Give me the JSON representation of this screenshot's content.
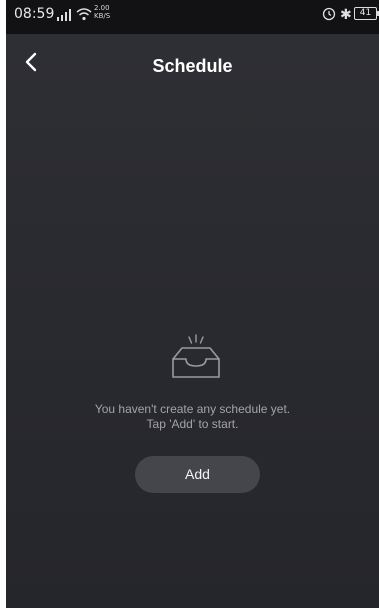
{
  "status_bar": {
    "time": "08:59",
    "speed_value": "2.00",
    "speed_unit": "KB/S",
    "battery": "41",
    "icons": [
      "signal-icon",
      "wifi-icon",
      "alarm-icon",
      "bluetooth-icon",
      "battery-icon"
    ]
  },
  "header": {
    "title": "Schedule",
    "back_icon": "chevron-left-icon"
  },
  "empty_state": {
    "icon": "empty-tray-icon",
    "line1": "You haven't create any schedule yet.",
    "line2": "Tap 'Add' to start."
  },
  "add_button": {
    "label": "Add"
  },
  "colors": {
    "background": "#2b2b30",
    "status_bar": "#121214",
    "button": "#45464c",
    "muted_text": "#a3a4a8"
  }
}
